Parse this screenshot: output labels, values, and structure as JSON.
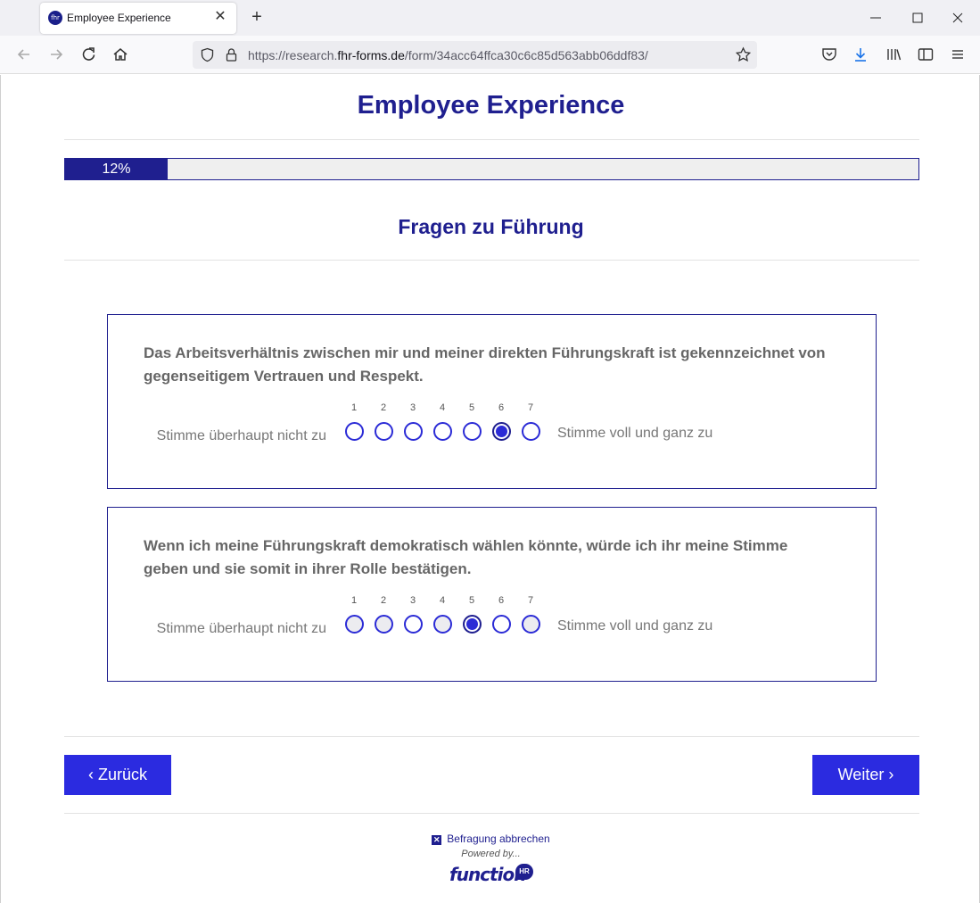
{
  "browser": {
    "tab_title": "Employee Experience",
    "favicon_text": "fhr",
    "url_prefix": "https://research.",
    "url_domain": "fhr-forms.de",
    "url_path": "/form/34acc64ffca30c6c85d563abb06ddf83/"
  },
  "page": {
    "title": "Employee Experience",
    "progress": {
      "percent": 12,
      "label": "12%"
    },
    "section_title": "Fragen zu Führung",
    "questions": [
      {
        "text": "Das Arbeitsverhältnis zwischen mir und meiner direkten Führungskraft ist gekennzeichnet von gegenseitigem Vertrauen und Respekt.",
        "left_label": "Stimme überhaupt nicht zu",
        "right_label": "Stimme voll und ganz zu",
        "options": [
          "1",
          "2",
          "3",
          "4",
          "5",
          "6",
          "7"
        ],
        "selected": 6
      },
      {
        "text": "Wenn ich meine Führungskraft demokratisch wählen könnte, würde ich ihr meine Stimme geben und sie somit in ihrer Rolle bestätigen.",
        "left_label": "Stimme überhaupt nicht zu",
        "right_label": "Stimme voll und ganz zu",
        "options": [
          "1",
          "2",
          "3",
          "4",
          "5",
          "6",
          "7"
        ],
        "selected": 5
      }
    ],
    "back_button": "Zurück",
    "next_button": "Weiter",
    "cancel_link": "Befragung abbrechen",
    "powered_by": "Powered by...",
    "logo_text": "function",
    "logo_badge": "HR"
  },
  "colors": {
    "brand": "#1f1f8f",
    "button": "#2b2be0"
  }
}
